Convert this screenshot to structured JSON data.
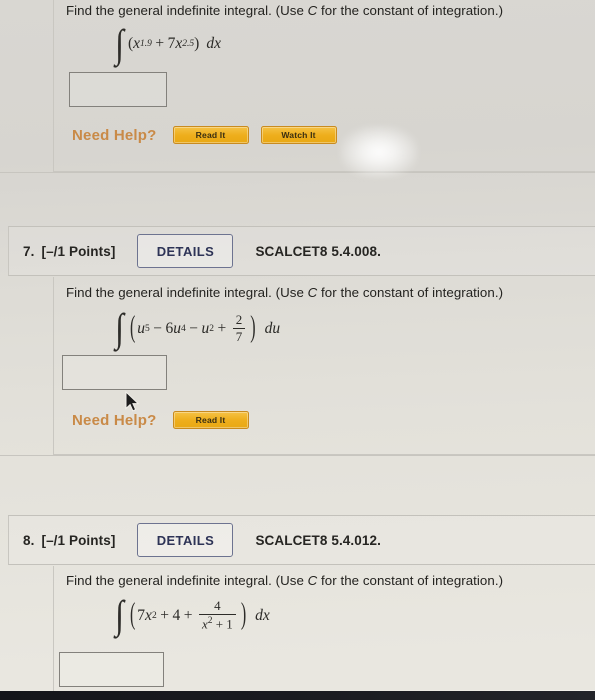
{
  "app": {
    "background_color": "#ddd9d3",
    "accent_orange": "#c98a47",
    "button_yellow": "#eeae1c",
    "details_blue": "#2d3356"
  },
  "problems": [
    {
      "id": "problem-6-partial",
      "number": "",
      "points": "",
      "details_label": "",
      "code": "",
      "prompt_before": "Find the general indefinite integral. (Use ",
      "prompt_var": "C",
      "prompt_after": " for the constant of integration.)",
      "integral": {
        "variable": "dx",
        "terms": "(x^1.9 + 7x^2.5)",
        "base1": "x",
        "exp1": "1.9",
        "op1": "+",
        "coef2": "7",
        "base2": "x",
        "exp2": "2.5"
      },
      "answer_value": "",
      "need_help_label": "Need Help?",
      "help_buttons": [
        "Read It",
        "Watch It"
      ]
    },
    {
      "id": "problem-7",
      "number": "7.",
      "points": "[–/1 Points]",
      "details_label": "DETAILS",
      "code": "SCALCET8 5.4.008.",
      "prompt_before": "Find the general indefinite integral. (Use ",
      "prompt_var": "C",
      "prompt_after": " for the constant of integration.)",
      "integral": {
        "variable": "du",
        "terms": "(u^5 - 6u^4 - u^2 + 2/7)",
        "t1_base": "u",
        "t1_exp": "5",
        "op1": "−",
        "t2_coef": "6",
        "t2_base": "u",
        "t2_exp": "4",
        "op2": "−",
        "t3_base": "u",
        "t3_exp": "2",
        "op3": "+",
        "frac_num": "2",
        "frac_den": "7"
      },
      "answer_value": "",
      "need_help_label": "Need Help?",
      "help_buttons": [
        "Read It"
      ]
    },
    {
      "id": "problem-8",
      "number": "8.",
      "points": "[–/1 Points]",
      "details_label": "DETAILS",
      "code": "SCALCET8 5.4.012.",
      "prompt_before": "Find the general indefinite integral. (Use ",
      "prompt_var": "C",
      "prompt_after": " for the constant of integration.)",
      "integral": {
        "variable": "dx",
        "terms": "(7x^2 + 4 + 4/(x^2 + 1))",
        "t1_coef": "7",
        "t1_base": "x",
        "t1_exp": "2",
        "op1": "+",
        "t2": "4",
        "op2": "+",
        "frac_num": "4",
        "frac_den_base": "x",
        "frac_den_exp": "2",
        "frac_den_tail": " + 1"
      },
      "answer_value": "",
      "need_help_label": "",
      "help_buttons": []
    }
  ]
}
